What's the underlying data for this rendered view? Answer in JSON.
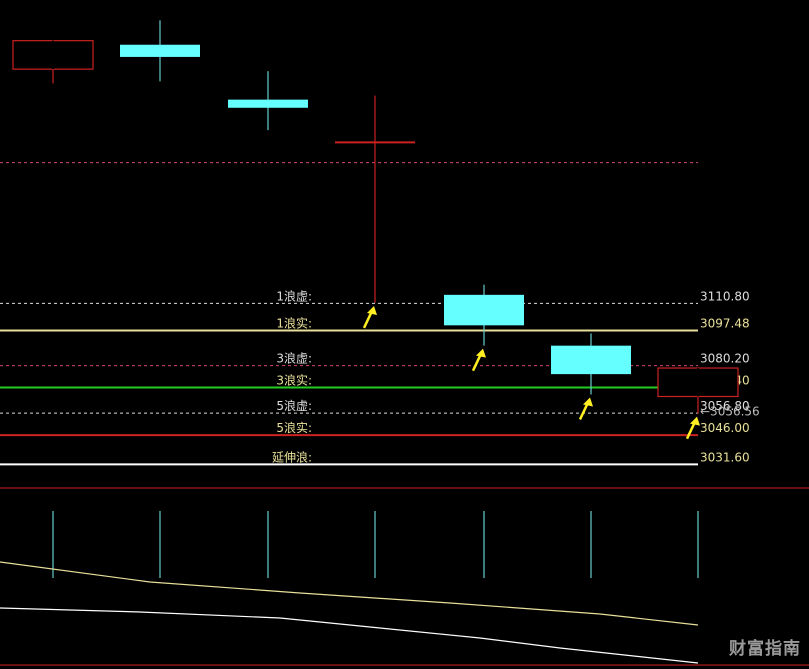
{
  "chart_data": {
    "type": "candlestick",
    "y_axis": {
      "min": 3020,
      "max": 3260,
      "scale": "linear"
    },
    "candles": [
      {
        "open": 3226,
        "close": 3240,
        "high": 3240,
        "low": 3219,
        "direction": "down"
      },
      {
        "open": 3232,
        "close": 3238,
        "high": 3250,
        "low": 3220,
        "direction": "up"
      },
      {
        "open": 3207,
        "close": 3211,
        "high": 3225,
        "low": 3196,
        "direction": "up"
      },
      {
        "open": 3190,
        "close": 3190,
        "high": 3213,
        "low": 3111,
        "direction": "doji"
      },
      {
        "open": 3100,
        "close": 3115,
        "high": 3120,
        "low": 3090,
        "direction": "up"
      },
      {
        "open": 3076,
        "close": 3090,
        "high": 3096,
        "low": 3066,
        "direction": "up"
      },
      {
        "open": 3079,
        "close": 3065,
        "high": 3079,
        "low": 3056.56,
        "direction": "down"
      }
    ],
    "levels": [
      {
        "label": "1浪虚:",
        "value": 3110.8,
        "value_text": "3110.80",
        "style": "dashed",
        "color": "#dddddd",
        "label_color": "#dddddd"
      },
      {
        "label": "1浪实:",
        "value": 3097.48,
        "value_text": "3097.48",
        "style": "solid",
        "color": "#e8e09a",
        "label_color": "#e8e09a"
      },
      {
        "label": "3浪虚:",
        "value": 3080.2,
        "value_text": "3080.20",
        "style": "dashed",
        "color": "#d04a70",
        "label_color": "#dddddd"
      },
      {
        "label": "3浪实:",
        "value": 3069.4,
        "value_text": "3069.40",
        "style": "solid",
        "color": "#22cc22",
        "label_color": "#e8e09a"
      },
      {
        "label": "5浪虚:",
        "value": 3056.8,
        "value_text": "3056.80",
        "style": "dashed",
        "color": "#dddddd",
        "label_color": "#dddddd"
      },
      {
        "label": "5浪实:",
        "value": 3046.0,
        "value_text": "3046.00",
        "style": "solid",
        "color": "#cc2222",
        "label_color": "#e8e09a"
      },
      {
        "label": "延伸浪:",
        "value": 3031.6,
        "value_text": "3031.60",
        "style": "solid",
        "color": "#ffffff",
        "label_color": "#e8e09a"
      }
    ],
    "low_marker": {
      "text": "←3056.56",
      "value": 3056.56
    },
    "extra_dashed_level": {
      "value": 3180,
      "color": "#d04a70"
    },
    "arrows_on_candles": [
      3,
      4,
      5,
      6
    ],
    "indicator_panel": {
      "lines": [
        {
          "color": "#e8e09a",
          "trend": "declining"
        },
        {
          "color": "#ffffff",
          "trend": "declining"
        }
      ]
    },
    "colors": {
      "up_body": "#66ffff",
      "down_body": "#cc2222",
      "wick_up": "#66cccc",
      "arrow": "#ffee22",
      "panel_divider": "#aa1a1a"
    }
  },
  "watermark": "财富指南"
}
